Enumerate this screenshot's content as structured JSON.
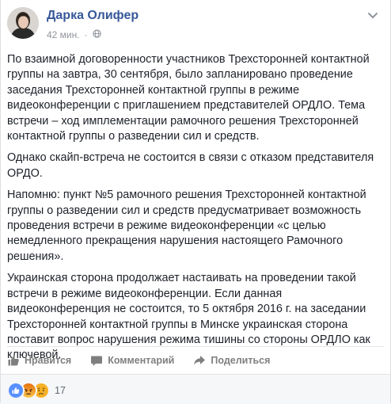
{
  "post": {
    "author": "Дарка Олифер",
    "time": "42 мин.",
    "separator": "·",
    "paragraphs": [
      "По взаимной договоренности участников Трехсторонней контактной группы на завтра, 30 сентября, было запланировано проведение заседания Трехсторонней контактной группы в режиме видеоконференции с приглашением представителей ОРДЛО. Тема встречи – ход имплементации рамочного решения Трехсторонней контактной группы о разведении сил и средств.",
      "Однако скайп-встреча не состоится в связи с отказом представителя ОРДО.",
      "Напомню: пункт №5 рамочного решения Трехсторонней контактной группы о разведении сил и средств предусматривает возможность проведения встречи в режиме видеоконференции «с целью немедленного прекращения нарушения настоящего Рамочного решения».",
      "Украинская сторона продолжает настаивать на проведении такой встречи в режиме видеоконференции. Если данная видеоконференция не состоится, то 5 октября 2016 г. на заседании Трехсторонней контактной группы в Минске украинская сторона поставит вопрос нарушения режима тишины со стороны ОРДЛО как ключевой."
    ]
  },
  "actions": {
    "like": "Нравится",
    "comment": "Комментарий",
    "share": "Поделиться"
  },
  "reactions": {
    "types": [
      "like-icon",
      "angry-icon",
      "sad-icon"
    ],
    "count": "17"
  },
  "colors": {
    "link": "#365899",
    "meta": "#90949c",
    "like_blue": "#5890ff",
    "angry": "#e9710f",
    "sad": "#f7b125"
  }
}
